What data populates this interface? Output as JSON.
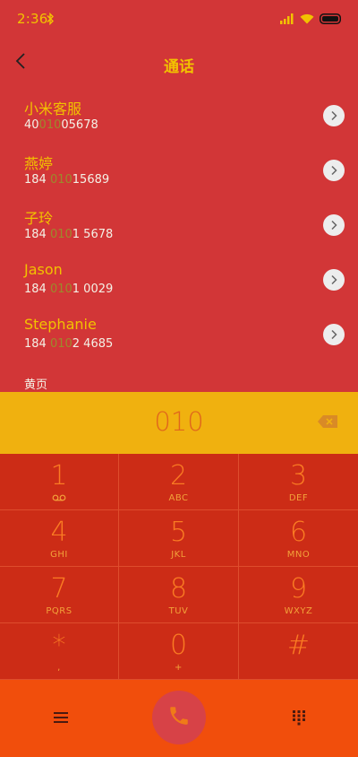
{
  "status_bar": {
    "time": "2:36"
  },
  "header": {
    "title": "通话"
  },
  "results": [
    {
      "name": "小米客服",
      "num_pre": "40",
      "num_hl": "010",
      "num_post": "05678"
    },
    {
      "name": "燕婷",
      "num_pre": "184 ",
      "num_hl": "010",
      "num_post": "15689"
    },
    {
      "name": "子玲",
      "num_pre": "184 ",
      "num_hl": "010",
      "num_post": "1 5678"
    },
    {
      "name": "Jason",
      "num_pre": "184 ",
      "num_hl": "010",
      "num_post": "1 0029"
    },
    {
      "name": "Stephanie",
      "num_pre": "184 ",
      "num_hl": "010",
      "num_post": "2 4685"
    }
  ],
  "yellow_pages_label": "黄页",
  "dial_input": "010",
  "keypad": [
    {
      "digit": "1",
      "letters": ""
    },
    {
      "digit": "2",
      "letters": "ABC"
    },
    {
      "digit": "3",
      "letters": "DEF"
    },
    {
      "digit": "4",
      "letters": "GHI"
    },
    {
      "digit": "5",
      "letters": "JKL"
    },
    {
      "digit": "6",
      "letters": "MNO"
    },
    {
      "digit": "7",
      "letters": "PQRS"
    },
    {
      "digit": "8",
      "letters": "TUV"
    },
    {
      "digit": "9",
      "letters": "WXYZ"
    },
    {
      "digit": "*",
      "letters": ","
    },
    {
      "digit": "0",
      "letters": "+"
    },
    {
      "digit": "#",
      "letters": ""
    }
  ],
  "icons": {
    "status": [
      "bluetooth-icon",
      "signal-icon",
      "wifi-icon",
      "battery-icon"
    ],
    "bottom": [
      "menu-icon",
      "phone-icon",
      "keypad-icon"
    ]
  },
  "colors": {
    "background": "#D23637",
    "accent_yellow": "#F2C200",
    "input_bar": "#F0B10F",
    "keypad": "#CC2C16",
    "key_digit": "#FA7B23",
    "bottom_bar": "#F14E0C",
    "call_button": "#D74247"
  }
}
